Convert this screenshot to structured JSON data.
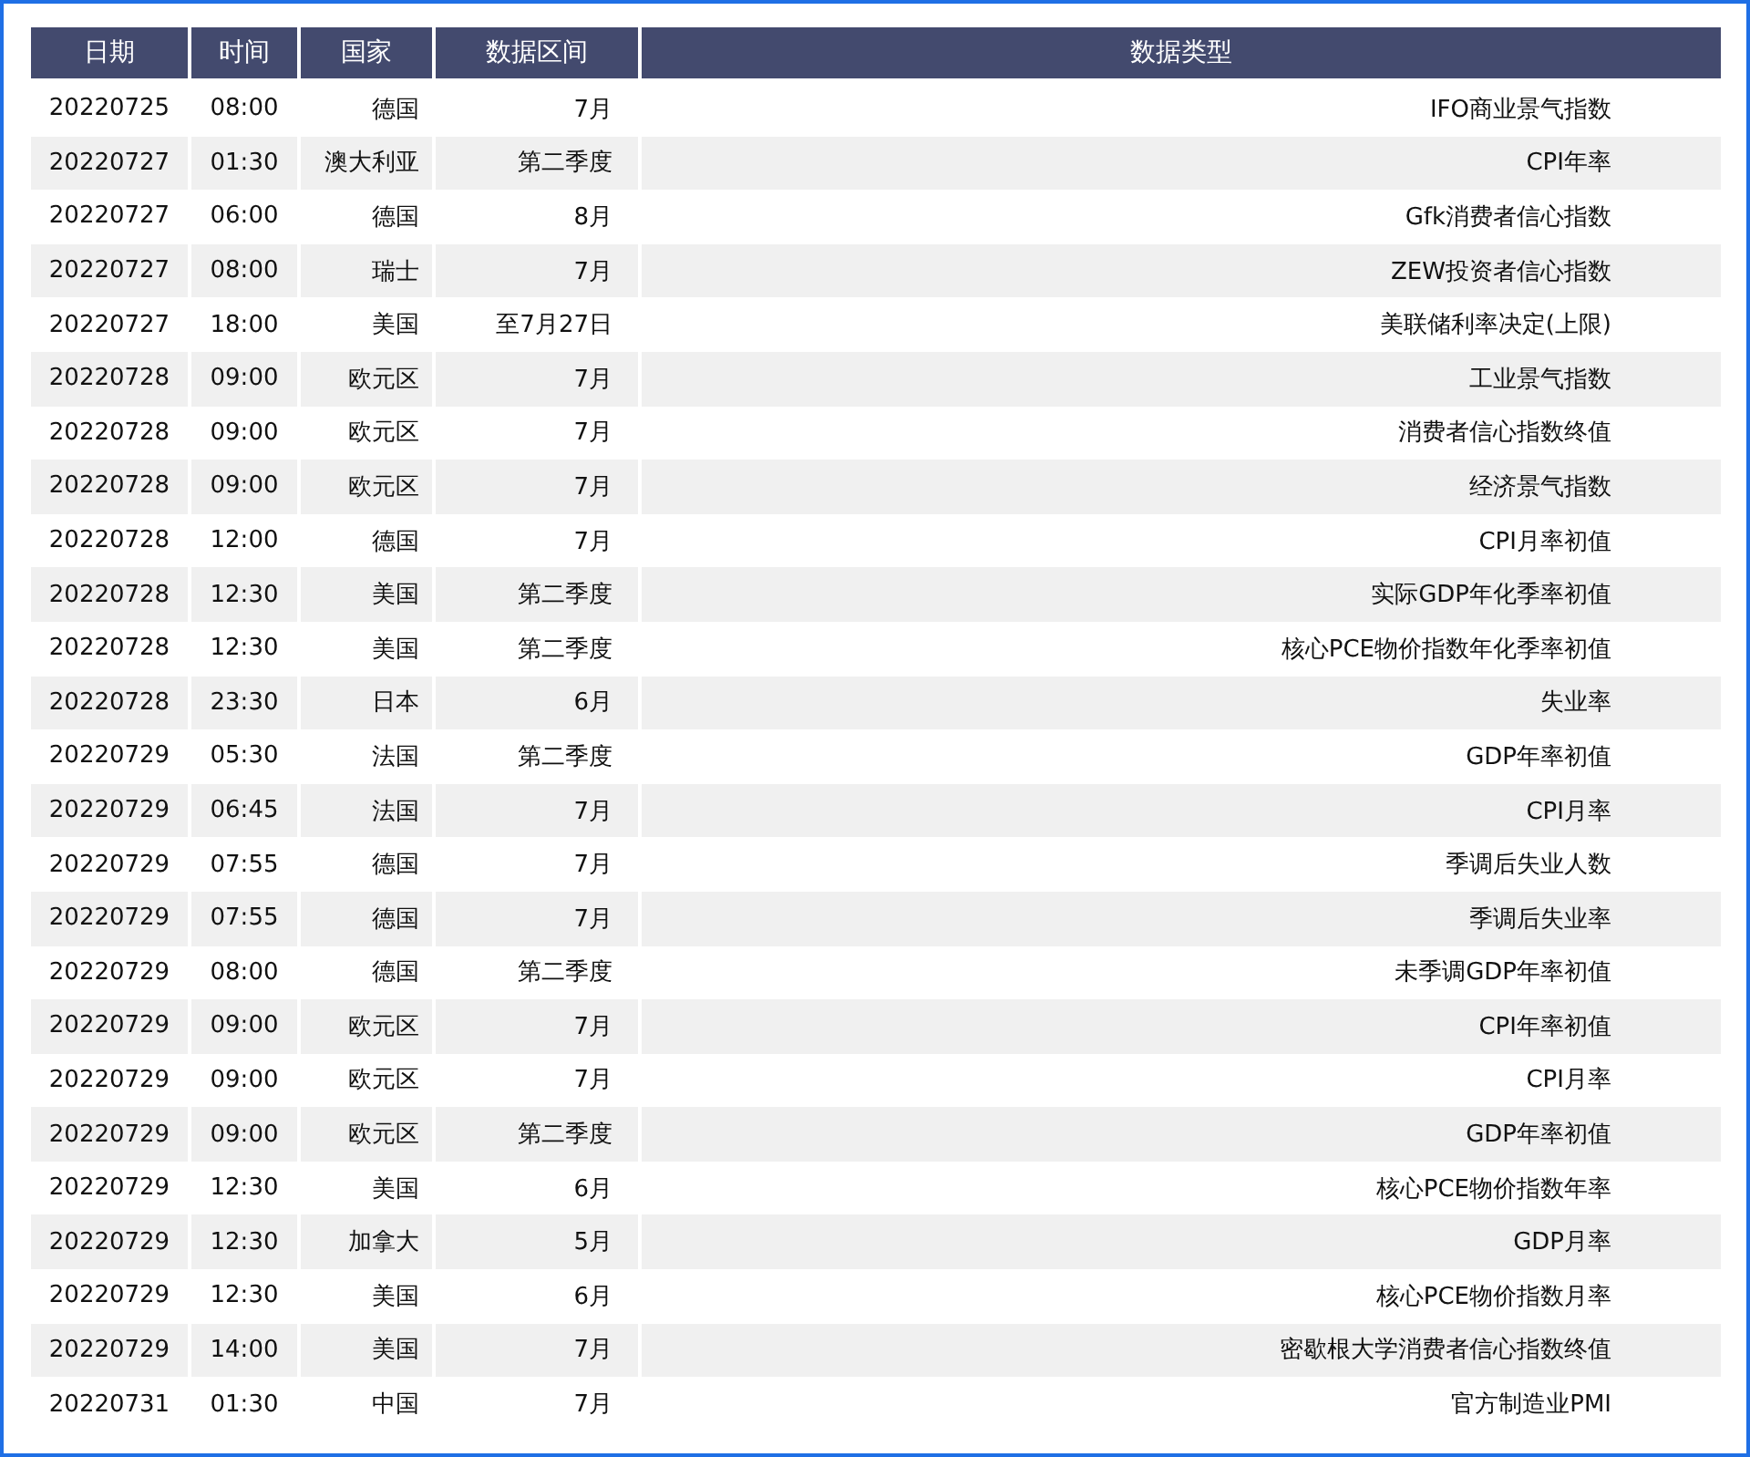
{
  "table": {
    "columns": [
      "日期",
      "时间",
      "国家",
      "数据区间",
      "数据类型"
    ],
    "rows": [
      [
        "20220725",
        "08:00",
        "德国",
        "7月",
        "IFO商业景气指数"
      ],
      [
        "20220727",
        "01:30",
        "澳大利亚",
        "第二季度",
        "CPI年率"
      ],
      [
        "20220727",
        "06:00",
        "德国",
        "8月",
        "Gfk消费者信心指数"
      ],
      [
        "20220727",
        "08:00",
        "瑞士",
        "7月",
        "ZEW投资者信心指数"
      ],
      [
        "20220727",
        "18:00",
        "美国",
        "至7月27日",
        "美联储利率决定(上限)"
      ],
      [
        "20220728",
        "09:00",
        "欧元区",
        "7月",
        "工业景气指数"
      ],
      [
        "20220728",
        "09:00",
        "欧元区",
        "7月",
        "消费者信心指数终值"
      ],
      [
        "20220728",
        "09:00",
        "欧元区",
        "7月",
        "经济景气指数"
      ],
      [
        "20220728",
        "12:00",
        "德国",
        "7月",
        "CPI月率初值"
      ],
      [
        "20220728",
        "12:30",
        "美国",
        "第二季度",
        "实际GDP年化季率初值"
      ],
      [
        "20220728",
        "12:30",
        "美国",
        "第二季度",
        "核心PCE物价指数年化季率初值"
      ],
      [
        "20220728",
        "23:30",
        "日本",
        "6月",
        "失业率"
      ],
      [
        "20220729",
        "05:30",
        "法国",
        "第二季度",
        "GDP年率初值"
      ],
      [
        "20220729",
        "06:45",
        "法国",
        "7月",
        "CPI月率"
      ],
      [
        "20220729",
        "07:55",
        "德国",
        "7月",
        "季调后失业人数"
      ],
      [
        "20220729",
        "07:55",
        "德国",
        "7月",
        "季调后失业率"
      ],
      [
        "20220729",
        "08:00",
        "德国",
        "第二季度",
        "未季调GDP年率初值"
      ],
      [
        "20220729",
        "09:00",
        "欧元区",
        "7月",
        "CPI年率初值"
      ],
      [
        "20220729",
        "09:00",
        "欧元区",
        "7月",
        "CPI月率"
      ],
      [
        "20220729",
        "09:00",
        "欧元区",
        "第二季度",
        "GDP年率初值"
      ],
      [
        "20220729",
        "12:30",
        "美国",
        "6月",
        "核心PCE物价指数年率"
      ],
      [
        "20220729",
        "12:30",
        "加拿大",
        "5月",
        "GDP月率"
      ],
      [
        "20220729",
        "12:30",
        "美国",
        "6月",
        "核心PCE物价指数月率"
      ],
      [
        "20220729",
        "14:00",
        "美国",
        "7月",
        "密歇根大学消费者信心指数终值"
      ],
      [
        "20220731",
        "01:30",
        "中国",
        "7月",
        "官方制造业PMI"
      ]
    ]
  }
}
